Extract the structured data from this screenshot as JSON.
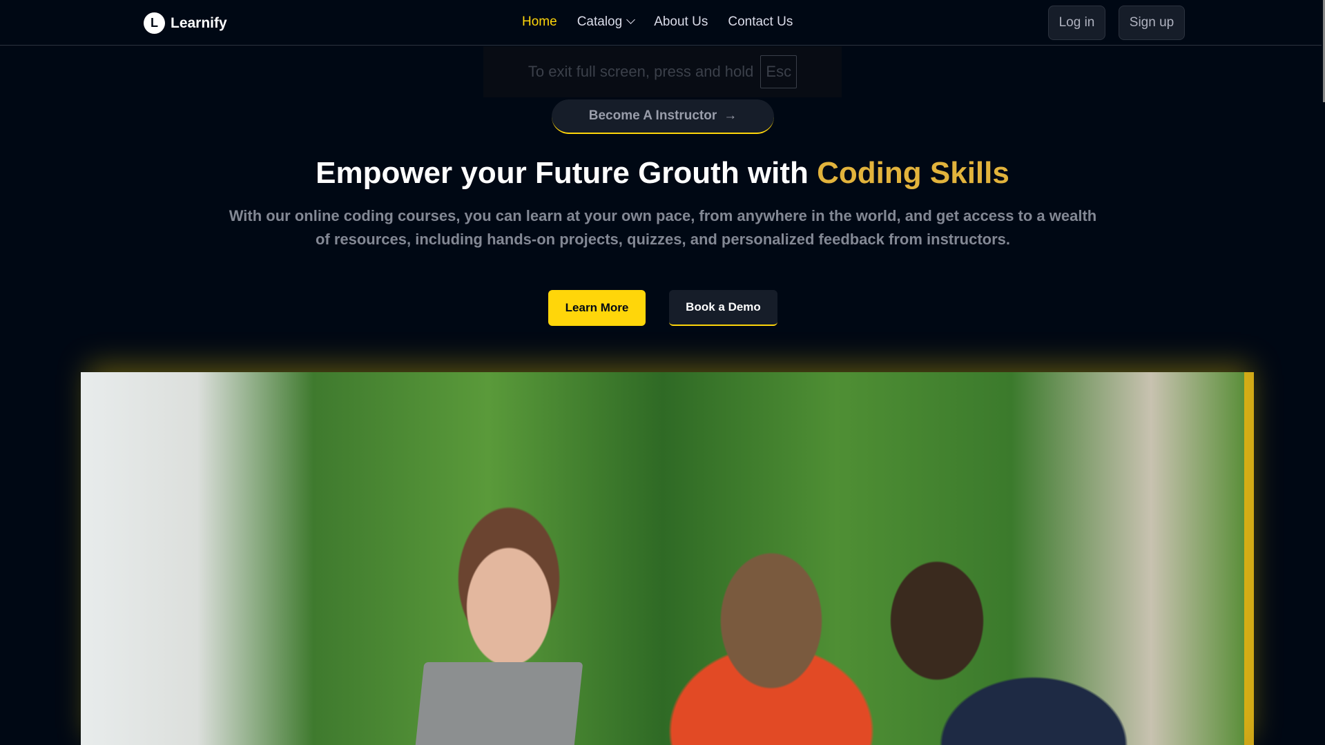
{
  "brand": {
    "logo_letter": "L",
    "name": "Learnify"
  },
  "nav": {
    "items": [
      {
        "label": "Home",
        "active": true
      },
      {
        "label": "Catalog"
      },
      {
        "label": "About Us"
      },
      {
        "label": "Contact Us"
      }
    ],
    "login": "Log in",
    "signup": "Sign up"
  },
  "fullscreen_notice": {
    "text": "To exit full screen, press and hold",
    "key": "Esc"
  },
  "hero": {
    "become_label": "Become A Instructor",
    "title_plain": "Empower your Future Grouth with ",
    "title_highlight": "Coding Skills",
    "subtitle": "With our online coding courses, you can learn at your own pace, from anywhere in the world, and get access to a wealth of resources, including hands-on projects, quizzes, and personalized feedback from instructors.",
    "learn_more": "Learn More",
    "book_demo": "Book a Demo"
  },
  "colors": {
    "accent": "#ffd60a",
    "highlight": "#e2b33c",
    "background": "#000814"
  }
}
